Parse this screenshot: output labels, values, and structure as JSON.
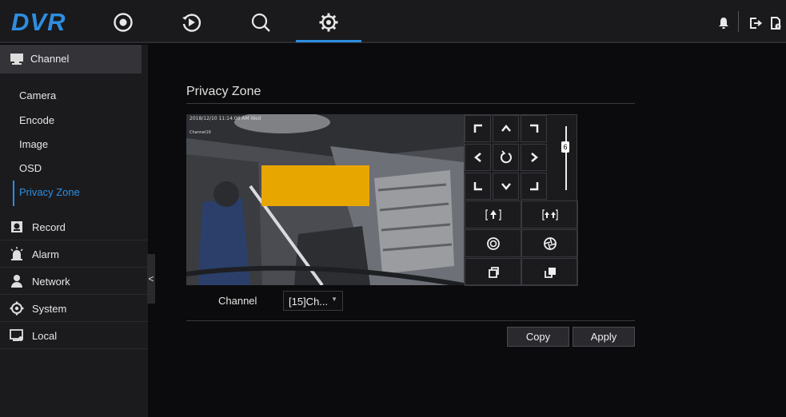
{
  "app": {
    "logo": "DVR"
  },
  "topnav": {
    "items": [
      {
        "name": "live-view",
        "icon": "live-view-icon"
      },
      {
        "name": "playback",
        "icon": "playback-icon"
      },
      {
        "name": "search",
        "icon": "search-icon"
      },
      {
        "name": "settings",
        "icon": "gear-icon",
        "active": true
      }
    ],
    "right_icons": [
      "bell-icon",
      "logout-icon",
      "device-info-icon"
    ]
  },
  "sidebar": {
    "section": {
      "label": "Channel",
      "icon": "channel-icon"
    },
    "sub_items": [
      {
        "label": "Camera"
      },
      {
        "label": "Encode"
      },
      {
        "label": "Image"
      },
      {
        "label": "OSD"
      },
      {
        "label": "Privacy Zone",
        "active": true
      }
    ],
    "menu": [
      {
        "label": "Record",
        "icon": "record-icon"
      },
      {
        "label": "Alarm",
        "icon": "alarm-icon"
      },
      {
        "label": "Network",
        "icon": "network-icon"
      },
      {
        "label": "System",
        "icon": "system-gear-icon"
      },
      {
        "label": "Local",
        "icon": "local-icon"
      }
    ],
    "collapse_glyph": "<"
  },
  "main": {
    "title": "Privacy Zone",
    "video": {
      "osd_time": "2018/12/10 11:14:00 AM Wed",
      "osd_channel": "Channel16"
    },
    "ptz": {
      "speed": "6"
    },
    "channel_label": "Channel",
    "channel_value": "[15]Ch...",
    "buttons": {
      "copy": "Copy",
      "apply": "Apply"
    }
  },
  "colors": {
    "accent": "#2d8ee0",
    "mask": "#e8a600",
    "background": "#0b0b0d"
  }
}
